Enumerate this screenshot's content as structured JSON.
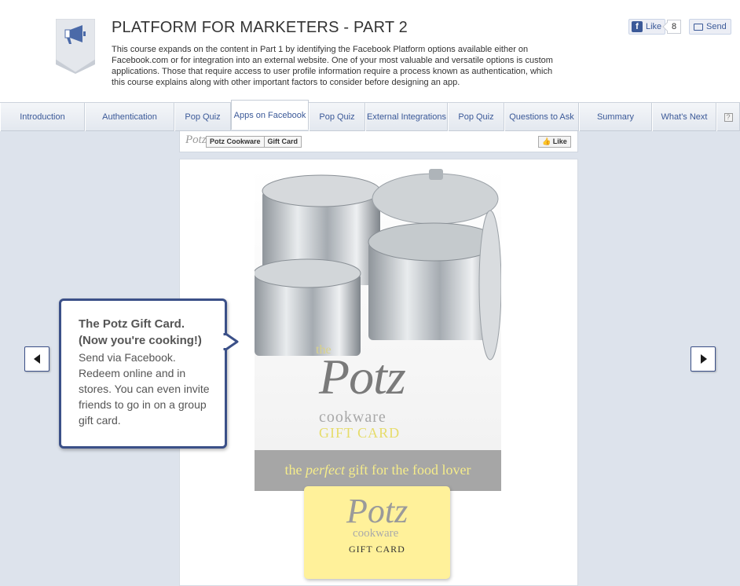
{
  "header": {
    "title": "PLATFORM FOR MARKETERS - PART 2",
    "description": "This course expands on the content in Part 1 by identifying the Facebook Platform options available either on Facebook.com or for integration into an external website. One of your most valuable and versatile options is custom applications. Those that require access to user profile information require a process known as authentication, which this course explains along with other important factors to consider before designing an app.",
    "badge_icon": "megaphone-icon",
    "like_label": "Like",
    "like_count": "8",
    "send_label": "Send"
  },
  "tabs": [
    {
      "label": "Introduction"
    },
    {
      "label": "Authentication"
    },
    {
      "label": "Pop Quiz"
    },
    {
      "label": "Apps on Facebook",
      "active": true
    },
    {
      "label": "Pop Quiz"
    },
    {
      "label": "External Integrations"
    },
    {
      "label": "Pop Quiz"
    },
    {
      "label": "Questions to Ask"
    },
    {
      "label": "Summary"
    },
    {
      "label": "What's Next"
    }
  ],
  "help_label": "?",
  "fb_bar": {
    "logo": "Potz",
    "tab1": "Potz Cookware",
    "tab2": "Gift Card",
    "like": "Like"
  },
  "product": {
    "the": "the",
    "potz": "Potz",
    "cookware": "cookware",
    "giftcard": "GIFT CARD",
    "strip_pre": "the ",
    "strip_em": "perfect",
    "strip_post": " gift for the food lover"
  },
  "card": {
    "potz": "Potz",
    "cookware": "cookware",
    "giftcard": "GIFT CARD"
  },
  "callout": {
    "heading_1": "The Potz Gift Card.",
    "heading_2": "(Now you're cooking!)",
    "body": "Send via Facebook. Redeem online and in stores. You can even invite friends to go in on a group gift card."
  },
  "colors": {
    "accent": "#3b5088",
    "facebook_blue": "#3b5998",
    "content_bg": "#dde3ec",
    "card_yellow": "#fff19a"
  }
}
